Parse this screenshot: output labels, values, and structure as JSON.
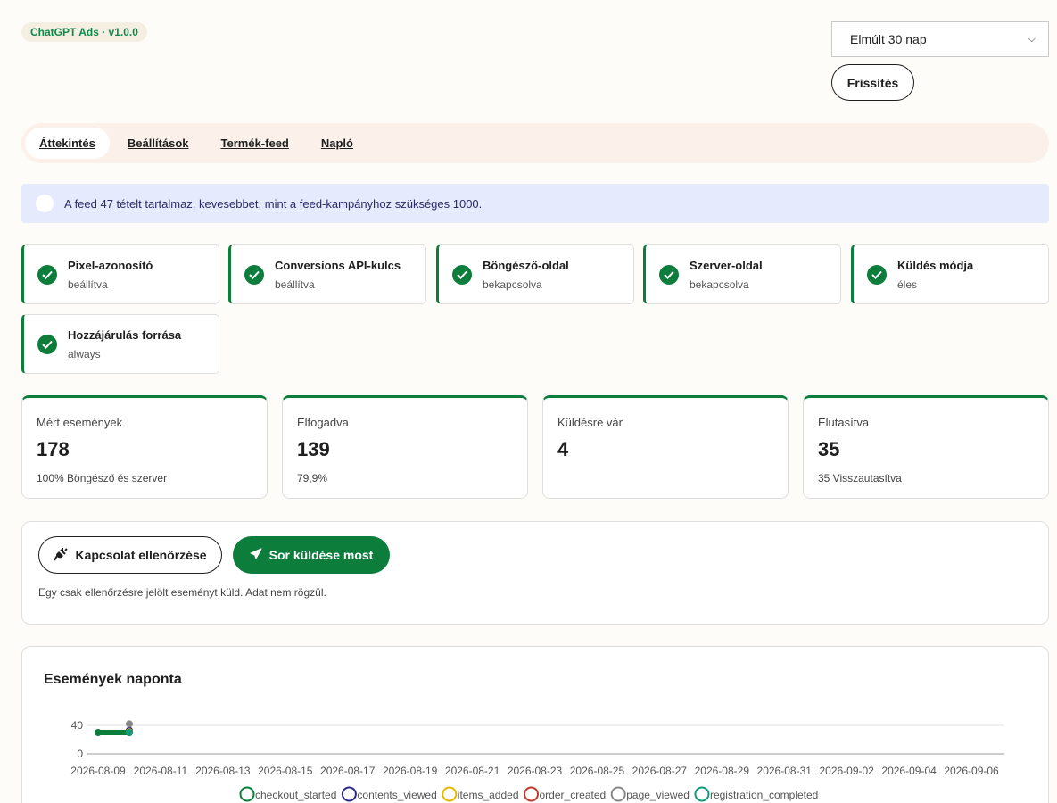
{
  "header": {
    "badge": "ChatGPT Ads · v1.0.0",
    "range_select": {
      "value": "Elmúlt 30 nap"
    },
    "refresh_label": "Frissítés"
  },
  "tabs": [
    {
      "label": "Áttekintés",
      "active": true
    },
    {
      "label": "Beállítások",
      "active": false
    },
    {
      "label": "Termék-feed",
      "active": false
    },
    {
      "label": "Napló",
      "active": false
    }
  ],
  "notice": "A feed 47 tételt tartalmaz, kevesebbet, mint a feed-kampányhoz szükséges 1000.",
  "status_checks": [
    {
      "title": "Pixel-azonosító",
      "value": "beállítva"
    },
    {
      "title": "Conversions API-kulcs",
      "value": "beállítva"
    },
    {
      "title": "Böngésző-oldal",
      "value": "bekapcsolva"
    },
    {
      "title": "Szerver-oldal",
      "value": "bekapcsolva"
    },
    {
      "title": "Küldés módja",
      "value": "éles"
    },
    {
      "title": "Hozzájárulás forrása",
      "value": "always"
    }
  ],
  "metrics": [
    {
      "label": "Mért események",
      "value": "178",
      "sub": "100% Böngésző és szerver"
    },
    {
      "label": "Elfogadva",
      "value": "139",
      "sub": "79,9%"
    },
    {
      "label": "Küldésre vár",
      "value": "4",
      "sub": ""
    },
    {
      "label": "Elutasítva",
      "value": "35",
      "sub": "35 Visszautasítva"
    }
  ],
  "actions": {
    "check_connection_label": "Kapcsolat ellenőrzése",
    "send_queue_label": "Sor küldése most",
    "note": "Egy csak ellenőrzésre jelölt eseményt küld. Adat nem rögzül."
  },
  "chart": {
    "title": "Események naponta"
  },
  "chart_data": {
    "type": "line",
    "title": "Események naponta",
    "xlabel": "",
    "ylabel": "",
    "x_range": [
      "2026-08-09",
      "2026-09-07"
    ],
    "y_ticks": [
      0,
      40
    ],
    "x_ticks": [
      "2026-08-09",
      "2026-08-11",
      "2026-08-13",
      "2026-08-15",
      "2026-08-17",
      "2026-08-19",
      "2026-08-21",
      "2026-08-23",
      "2026-08-25",
      "2026-08-27",
      "2026-08-29",
      "2026-08-31",
      "2026-09-02",
      "2026-09-04",
      "2026-09-06"
    ],
    "grid": true,
    "legend_position": "bottom",
    "series": [
      {
        "name": "checkout_started",
        "color": "#0d7d3c",
        "x": [
          "2026-08-09",
          "2026-08-10"
        ],
        "y": [
          30,
          30
        ]
      },
      {
        "name": "contents_viewed",
        "color": "#2a2a8a",
        "x": [
          "2026-08-10"
        ],
        "y": [
          33
        ]
      },
      {
        "name": "items_added",
        "color": "#e6b800",
        "x": [
          "2026-08-10"
        ],
        "y": [
          31
        ]
      },
      {
        "name": "order_created",
        "color": "#c0392b",
        "x": [
          "2026-08-10"
        ],
        "y": [
          30
        ]
      },
      {
        "name": "page_viewed",
        "color": "#888888",
        "x": [
          "2026-08-10"
        ],
        "y": [
          42
        ]
      },
      {
        "name": "registration_completed",
        "color": "#0f9b7a",
        "x": [
          "2026-08-10"
        ],
        "y": [
          30
        ]
      }
    ]
  }
}
